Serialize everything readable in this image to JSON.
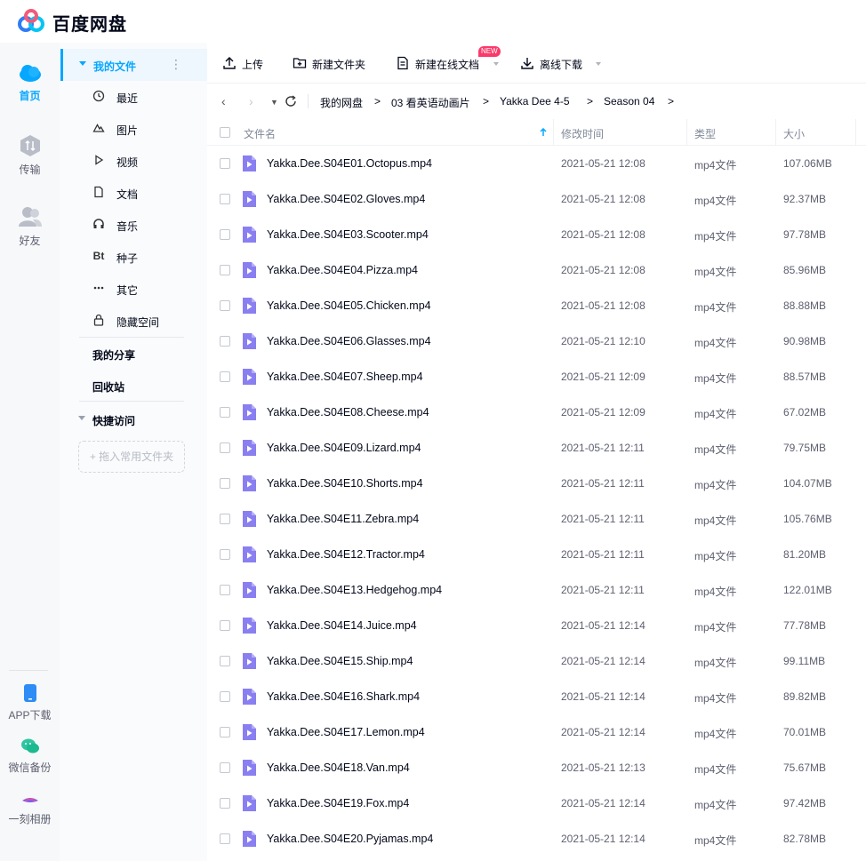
{
  "app": {
    "title": "百度网盘"
  },
  "colors": {
    "accent": "#06a7ff",
    "badge": "#fa3a6a",
    "video_icon": "#8a7ff0"
  },
  "leftnav": {
    "items": [
      {
        "label": "首页",
        "icon": "cloud-icon",
        "active": true
      },
      {
        "label": "传输",
        "icon": "transfer-icon",
        "active": false
      },
      {
        "label": "好友",
        "icon": "friends-icon",
        "active": false
      }
    ],
    "bottom": [
      {
        "label": "APP下载",
        "icon": "phone-icon"
      },
      {
        "label": "微信备份",
        "icon": "wechat-icon"
      },
      {
        "label": "一刻相册",
        "icon": "album-icon"
      }
    ]
  },
  "sidebar": {
    "my_files": "我的文件",
    "categories": [
      {
        "label": "最近",
        "icon": "clock-icon"
      },
      {
        "label": "图片",
        "icon": "image-icon"
      },
      {
        "label": "视频",
        "icon": "play-icon"
      },
      {
        "label": "文档",
        "icon": "document-icon"
      },
      {
        "label": "音乐",
        "icon": "headphones-icon"
      },
      {
        "label": "种子",
        "icon": "bt-icon",
        "glyph": "Bt"
      },
      {
        "label": "其它",
        "icon": "more-icon"
      },
      {
        "label": "隐藏空间",
        "icon": "lock-icon"
      }
    ],
    "my_share": "我的分享",
    "recycle": "回收站",
    "quick_access": "快捷访问",
    "drop_hint": "+ 拖入常用文件夹"
  },
  "toolbar": {
    "upload": "上传",
    "new_folder": "新建文件夹",
    "new_online_doc": "新建在线文档",
    "new_badge": "NEW",
    "offline_download": "离线下载"
  },
  "breadcrumb": {
    "items": [
      "我的网盘",
      "03 看英语动画片",
      "Yakka Dee 4-5",
      "Season 04"
    ],
    "separator": ">"
  },
  "table": {
    "columns": {
      "name": "文件名",
      "modified": "修改时间",
      "type": "类型",
      "size": "大小"
    },
    "rows": [
      {
        "name": "Yakka.Dee.S04E01.Octopus.mp4",
        "time": "2021-05-21 12:08",
        "type": "mp4文件",
        "size": "107.06MB"
      },
      {
        "name": "Yakka.Dee.S04E02.Gloves.mp4",
        "time": "2021-05-21 12:08",
        "type": "mp4文件",
        "size": "92.37MB"
      },
      {
        "name": "Yakka.Dee.S04E03.Scooter.mp4",
        "time": "2021-05-21 12:08",
        "type": "mp4文件",
        "size": "97.78MB"
      },
      {
        "name": "Yakka.Dee.S04E04.Pizza.mp4",
        "time": "2021-05-21 12:08",
        "type": "mp4文件",
        "size": "85.96MB"
      },
      {
        "name": "Yakka.Dee.S04E05.Chicken.mp4",
        "time": "2021-05-21 12:08",
        "type": "mp4文件",
        "size": "88.88MB"
      },
      {
        "name": "Yakka.Dee.S04E06.Glasses.mp4",
        "time": "2021-05-21 12:10",
        "type": "mp4文件",
        "size": "90.98MB"
      },
      {
        "name": "Yakka.Dee.S04E07.Sheep.mp4",
        "time": "2021-05-21 12:09",
        "type": "mp4文件",
        "size": "88.57MB"
      },
      {
        "name": "Yakka.Dee.S04E08.Cheese.mp4",
        "time": "2021-05-21 12:09",
        "type": "mp4文件",
        "size": "67.02MB"
      },
      {
        "name": "Yakka.Dee.S04E09.Lizard.mp4",
        "time": "2021-05-21 12:11",
        "type": "mp4文件",
        "size": "79.75MB"
      },
      {
        "name": "Yakka.Dee.S04E10.Shorts.mp4",
        "time": "2021-05-21 12:11",
        "type": "mp4文件",
        "size": "104.07MB"
      },
      {
        "name": "Yakka.Dee.S04E11.Zebra.mp4",
        "time": "2021-05-21 12:11",
        "type": "mp4文件",
        "size": "105.76MB"
      },
      {
        "name": "Yakka.Dee.S04E12.Tractor.mp4",
        "time": "2021-05-21 12:11",
        "type": "mp4文件",
        "size": "81.20MB"
      },
      {
        "name": "Yakka.Dee.S04E13.Hedgehog.mp4",
        "time": "2021-05-21 12:11",
        "type": "mp4文件",
        "size": "122.01MB"
      },
      {
        "name": "Yakka.Dee.S04E14.Juice.mp4",
        "time": "2021-05-21 12:14",
        "type": "mp4文件",
        "size": "77.78MB"
      },
      {
        "name": "Yakka.Dee.S04E15.Ship.mp4",
        "time": "2021-05-21 12:14",
        "type": "mp4文件",
        "size": "99.11MB"
      },
      {
        "name": "Yakka.Dee.S04E16.Shark.mp4",
        "time": "2021-05-21 12:14",
        "type": "mp4文件",
        "size": "89.82MB"
      },
      {
        "name": "Yakka.Dee.S04E17.Lemon.mp4",
        "time": "2021-05-21 12:14",
        "type": "mp4文件",
        "size": "70.01MB"
      },
      {
        "name": "Yakka.Dee.S04E18.Van.mp4",
        "time": "2021-05-21 12:13",
        "type": "mp4文件",
        "size": "75.67MB"
      },
      {
        "name": "Yakka.Dee.S04E19.Fox.mp4",
        "time": "2021-05-21 12:14",
        "type": "mp4文件",
        "size": "97.42MB"
      },
      {
        "name": "Yakka.Dee.S04E20.Pyjamas.mp4",
        "time": "2021-05-21 12:14",
        "type": "mp4文件",
        "size": "82.78MB"
      }
    ]
  }
}
